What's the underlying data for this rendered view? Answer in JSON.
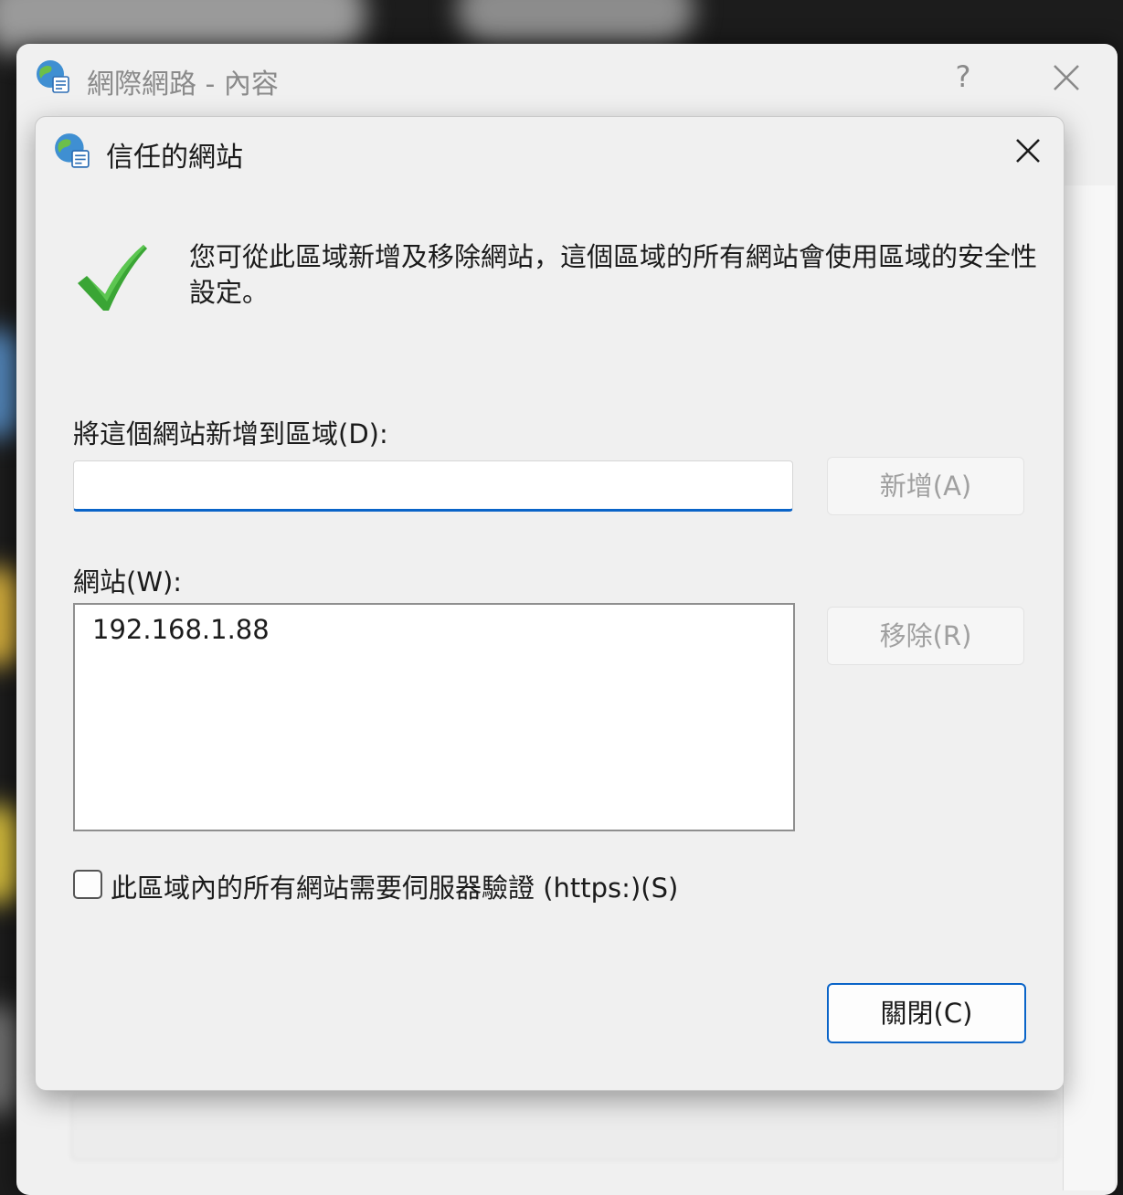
{
  "parent_window": {
    "title": "網際網路 - 內容",
    "help_label": "?"
  },
  "dialog": {
    "title": "信任的網站",
    "description": "您可從此區域新增及移除網站，這個區域的所有網站會使用區域的安全性設定。",
    "add_section": {
      "label": "將這個網站新增到區域(D):",
      "input_value": "",
      "add_button_label": "新增(A)"
    },
    "websites_section": {
      "label": "網站(W):",
      "items": [
        "192.168.1.88"
      ],
      "remove_button_label": "移除(R)"
    },
    "https_option": {
      "label": "此區域內的所有網站需要伺服器驗證 (https:)(S)",
      "checked": false
    },
    "close_button_label": "關閉(C)"
  },
  "colors": {
    "accent": "#0a64c8",
    "check_green": "#3aa535"
  }
}
